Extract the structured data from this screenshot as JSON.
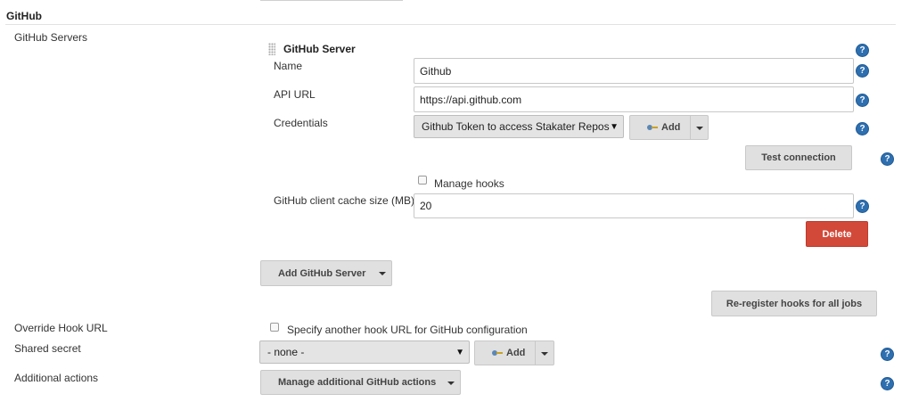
{
  "section": {
    "title": "GitHub"
  },
  "servers": {
    "label": "GitHub Servers",
    "server_title": "GitHub Server",
    "name_label": "Name",
    "name_value": "Github",
    "api_url_label": "API URL",
    "api_url_value": "https://api.github.com",
    "credentials_label": "Credentials",
    "credentials_selected": "Github Token to access Stakater Repos",
    "credentials_add_label": "Add",
    "test_connection_label": "Test connection",
    "manage_hooks_label": "Manage hooks",
    "cache_size_label": "GitHub client cache size (MB)",
    "cache_size_value": "20",
    "delete_label": "Delete",
    "add_server_label": "Add GitHub Server",
    "reregister_label": "Re-register hooks for all jobs"
  },
  "override_hook": {
    "label": "Override Hook URL",
    "checkbox_label": "Specify another hook URL for GitHub configuration"
  },
  "shared_secret": {
    "label": "Shared secret",
    "selected": "- none -",
    "add_label": "Add"
  },
  "additional_actions": {
    "label": "Additional actions",
    "button_label": "Manage additional GitHub actions"
  },
  "help": {
    "glyph": "?"
  },
  "icons": {
    "help": "help-icon",
    "key": "key-icon",
    "caret": "chevron-down-icon",
    "drag": "drag-handle-icon"
  },
  "colors": {
    "help_blue": "#2e6fb0",
    "delete_red": "#d24939",
    "button_gray": "#e0e0e0"
  }
}
